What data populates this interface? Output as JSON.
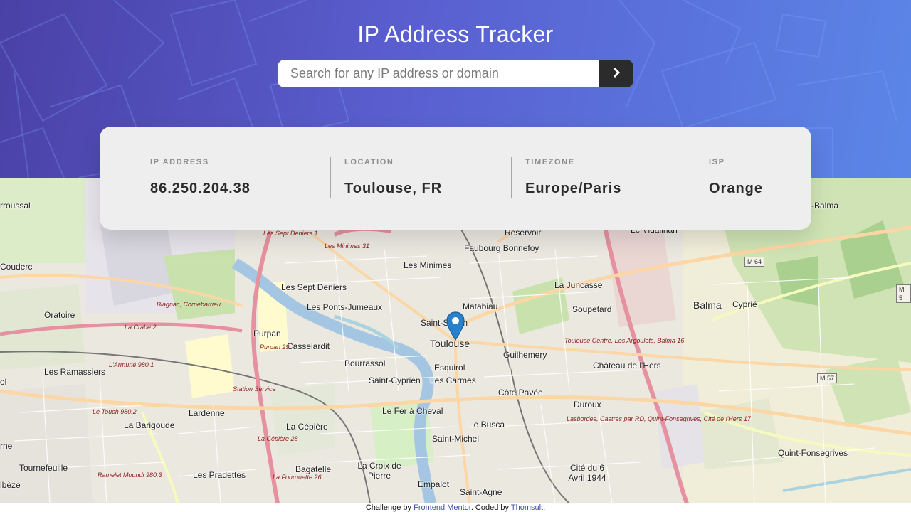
{
  "header": {
    "title": "IP Address Tracker",
    "search_placeholder": "Search for any IP address or domain",
    "search_value": "",
    "submit_icon": "chevron-right-icon"
  },
  "info": {
    "ip": {
      "label": "IP ADDRESS",
      "value": "86.250.204.38"
    },
    "location": {
      "label": "LOCATION",
      "value": "Toulouse, FR"
    },
    "timezone": {
      "label": "TIMEZONE",
      "value": "Europe/Paris"
    },
    "isp": {
      "label": "ISP",
      "value": "Orange"
    }
  },
  "map": {
    "marker_icon": "location-pin-icon",
    "places": [
      "Toulouse",
      "Saint-Sernin",
      "Matabiau",
      "Les Minimes",
      "Les Sept Deniers",
      "Les Ponts-Jumeaux",
      "Purpan",
      "Casselardit",
      "Bourrassol",
      "Saint-Cyprien",
      "Esquirol",
      "Les Carmes",
      "Guilhemery",
      "Château de l'Hers",
      "Côte Pavée",
      "Le Fer à Cheval",
      "La Cépière",
      "Le Busca",
      "Saint-Michel",
      "Bagatelle",
      "La Croix de Pierre",
      "Empalot",
      "Saint-Agne",
      "Cité du 6 Avril 1944",
      "Duroux",
      "La Juncasse",
      "Soupetard",
      "Balma",
      "Cyprié",
      "Faubourg Bonnefoy",
      "Réservoir",
      "Le Vidailhan",
      "Lardenne",
      "La Barigoude",
      "Les Ramassiers",
      "Oratoire",
      "Tournefeuille",
      "Les Pradettes",
      "Quint-Fonsegrives",
      "rroussal",
      "Couderc",
      "-Balma",
      "rne",
      "lbèze",
      "ol"
    ],
    "road_labels": [
      "Les Sept Deniers 1",
      "Les Minimes 31",
      "Blagnac, Cornebarrieu",
      "La Crabe 2",
      "Purpan 29",
      "Station Service",
      "L'Armurié 980.1",
      "Le Touch 980.2",
      "La Cépière 28",
      "La Fourquette 26",
      "Ramelet Moundi 980.3",
      "Toulouse Centre, Les Argoulets, Balma 16",
      "Lasbordes, Castres par RD, Quint-Fonsegrives, Cité de l'Hers 17"
    ],
    "shields": [
      "M 64",
      "M 57",
      "M 5"
    ]
  },
  "footer": {
    "prefix": "Challenge by",
    "link1": "Frontend Mentor",
    "middle": ". Coded by",
    "link2": "Thomsult",
    "suffix": "."
  }
}
